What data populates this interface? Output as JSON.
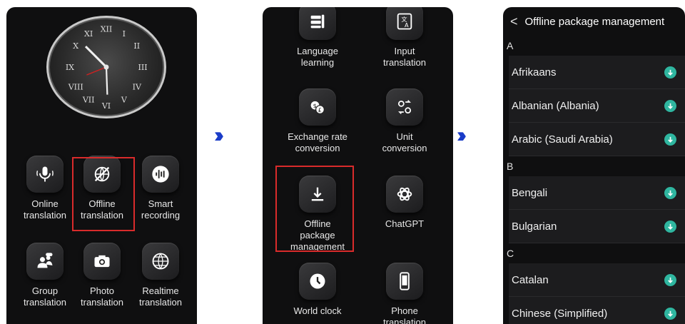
{
  "panel1": {
    "tiles": [
      {
        "label": "Online\ntranslation",
        "icon": "microphone-icon"
      },
      {
        "label": "Offline\ntranslation",
        "icon": "offline-globe-icon"
      },
      {
        "label": "Smart\nrecording",
        "icon": "waveform-icon"
      },
      {
        "label": "Group\ntranslation",
        "icon": "group-people-icon"
      },
      {
        "label": "Photo\ntranslation",
        "icon": "camera-icon"
      },
      {
        "label": "Realtime\ntranslation",
        "icon": "globe-icon"
      }
    ]
  },
  "panel2": {
    "tiles": [
      {
        "label": "Language\nlearning",
        "icon": "books-icon"
      },
      {
        "label": "Input translation",
        "icon": "input-translate-icon"
      },
      {
        "label": "Exchange rate\nconversion",
        "icon": "currency-exchange-icon"
      },
      {
        "label": "Unit conversion",
        "icon": "unit-conversion-icon"
      },
      {
        "label": "Offline package\nmanagement",
        "icon": "download-icon"
      },
      {
        "label": "ChatGPT",
        "icon": "chatgpt-icon"
      },
      {
        "label": "World clock",
        "icon": "clock-icon"
      },
      {
        "label": "Phone translation",
        "icon": "phone-icon"
      }
    ]
  },
  "panel3": {
    "title": "Offline package management",
    "back_glyph": "<",
    "sections": [
      {
        "letter": "A",
        "items": [
          "Afrikaans",
          "Albanian (Albania)",
          "Arabic (Saudi Arabia)"
        ]
      },
      {
        "letter": "B",
        "items": [
          "Bengali",
          "Bulgarian"
        ]
      },
      {
        "letter": "C",
        "items": [
          "Catalan",
          "Chinese (Simplified)"
        ]
      }
    ]
  },
  "arrows": "›››",
  "colors": {
    "highlight": "#d92b2b",
    "arrow": "#1a3cc8",
    "download": "#2fb6a0"
  }
}
